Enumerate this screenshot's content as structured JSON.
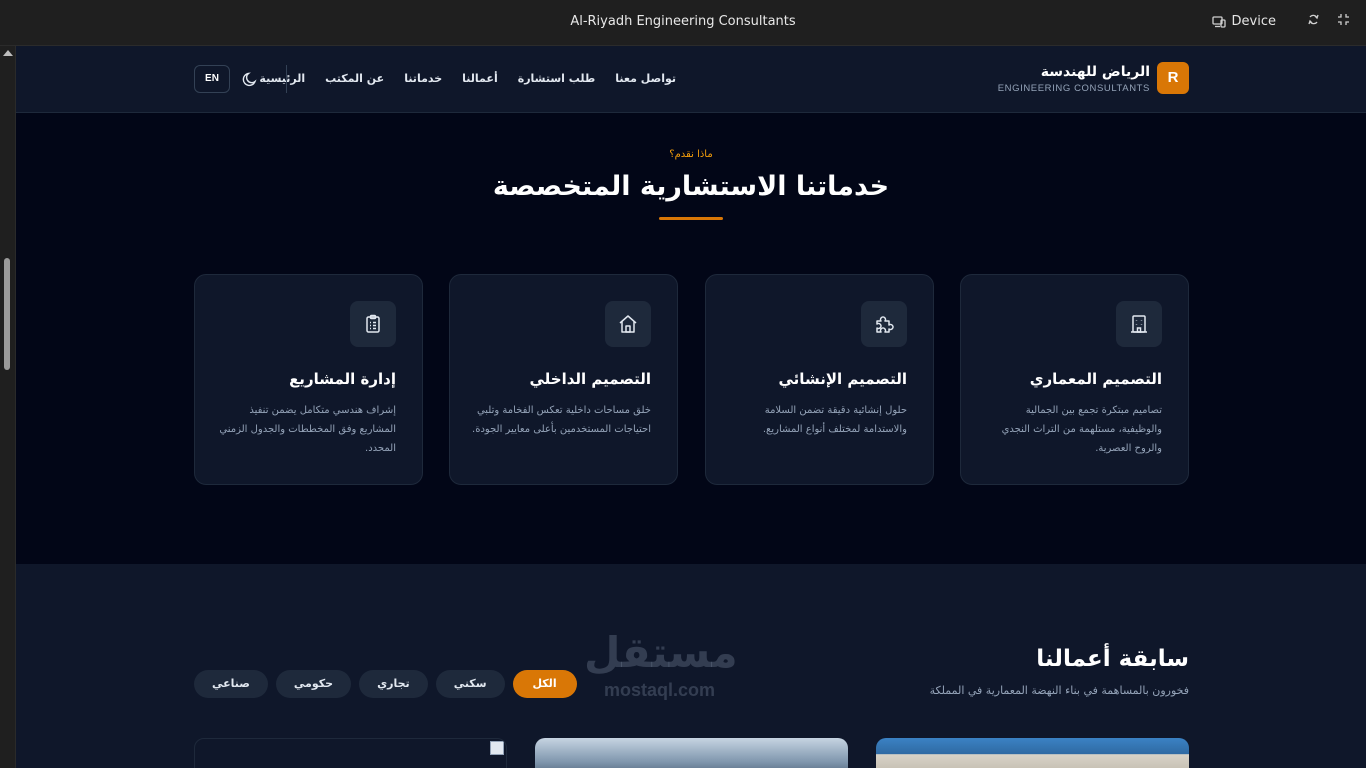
{
  "window": {
    "title": "Al-Riyadh Engineering Consultants",
    "device_label": "Device"
  },
  "header": {
    "logo_letter": "R",
    "brand_name": "الرياض للهندسة",
    "brand_sub": "ENGINEERING CONSULTANTS",
    "nav": [
      {
        "label": "الرئيسية"
      },
      {
        "label": "عن المكتب"
      },
      {
        "label": "خدماتنا"
      },
      {
        "label": "أعمالنا"
      },
      {
        "label": "طلب استشارة"
      },
      {
        "label": "تواصل معنا"
      }
    ],
    "lang_button": "EN"
  },
  "services": {
    "eyebrow": "ماذا نقدم؟",
    "title": "خدماتنا الاستشارية المتخصصة",
    "cards": [
      {
        "icon": "building-icon",
        "title": "التصميم المعماري",
        "desc": "تصاميم مبتكرة تجمع بين الجمالية والوظيفية، مستلهمة من التراث النجدي والروح العصرية."
      },
      {
        "icon": "puzzle-icon",
        "title": "التصميم الإنشائي",
        "desc": "حلول إنشائية دقيقة تضمن السلامة والاستدامة لمختلف أنواع المشاريع."
      },
      {
        "icon": "home-icon",
        "title": "التصميم الداخلي",
        "desc": "خلق مساحات داخلية تعكس الفخامة وتلبي احتياجات المستخدمين بأعلى معايير الجودة."
      },
      {
        "icon": "clipboard-icon",
        "title": "إدارة المشاريع",
        "desc": "إشراف هندسي متكامل يضمن تنفيذ المشاريع وفق المخططات والجدول الزمني المحدد."
      }
    ]
  },
  "works": {
    "title": "سابقة أعمالنا",
    "subtitle": "فخورون بالمساهمة في بناء النهضة المعمارية في المملكة",
    "filters": [
      {
        "label": "الكل",
        "active": true
      },
      {
        "label": "سكني",
        "active": false
      },
      {
        "label": "تجاري",
        "active": false
      },
      {
        "label": "حكومي",
        "active": false
      },
      {
        "label": "صناعي",
        "active": false
      }
    ]
  },
  "watermark": {
    "text": "مستقل",
    "sub": "mostaql.com"
  },
  "colors": {
    "accent": "#d97706",
    "page_bg": "#020617",
    "card_bg": "#0f172a"
  }
}
